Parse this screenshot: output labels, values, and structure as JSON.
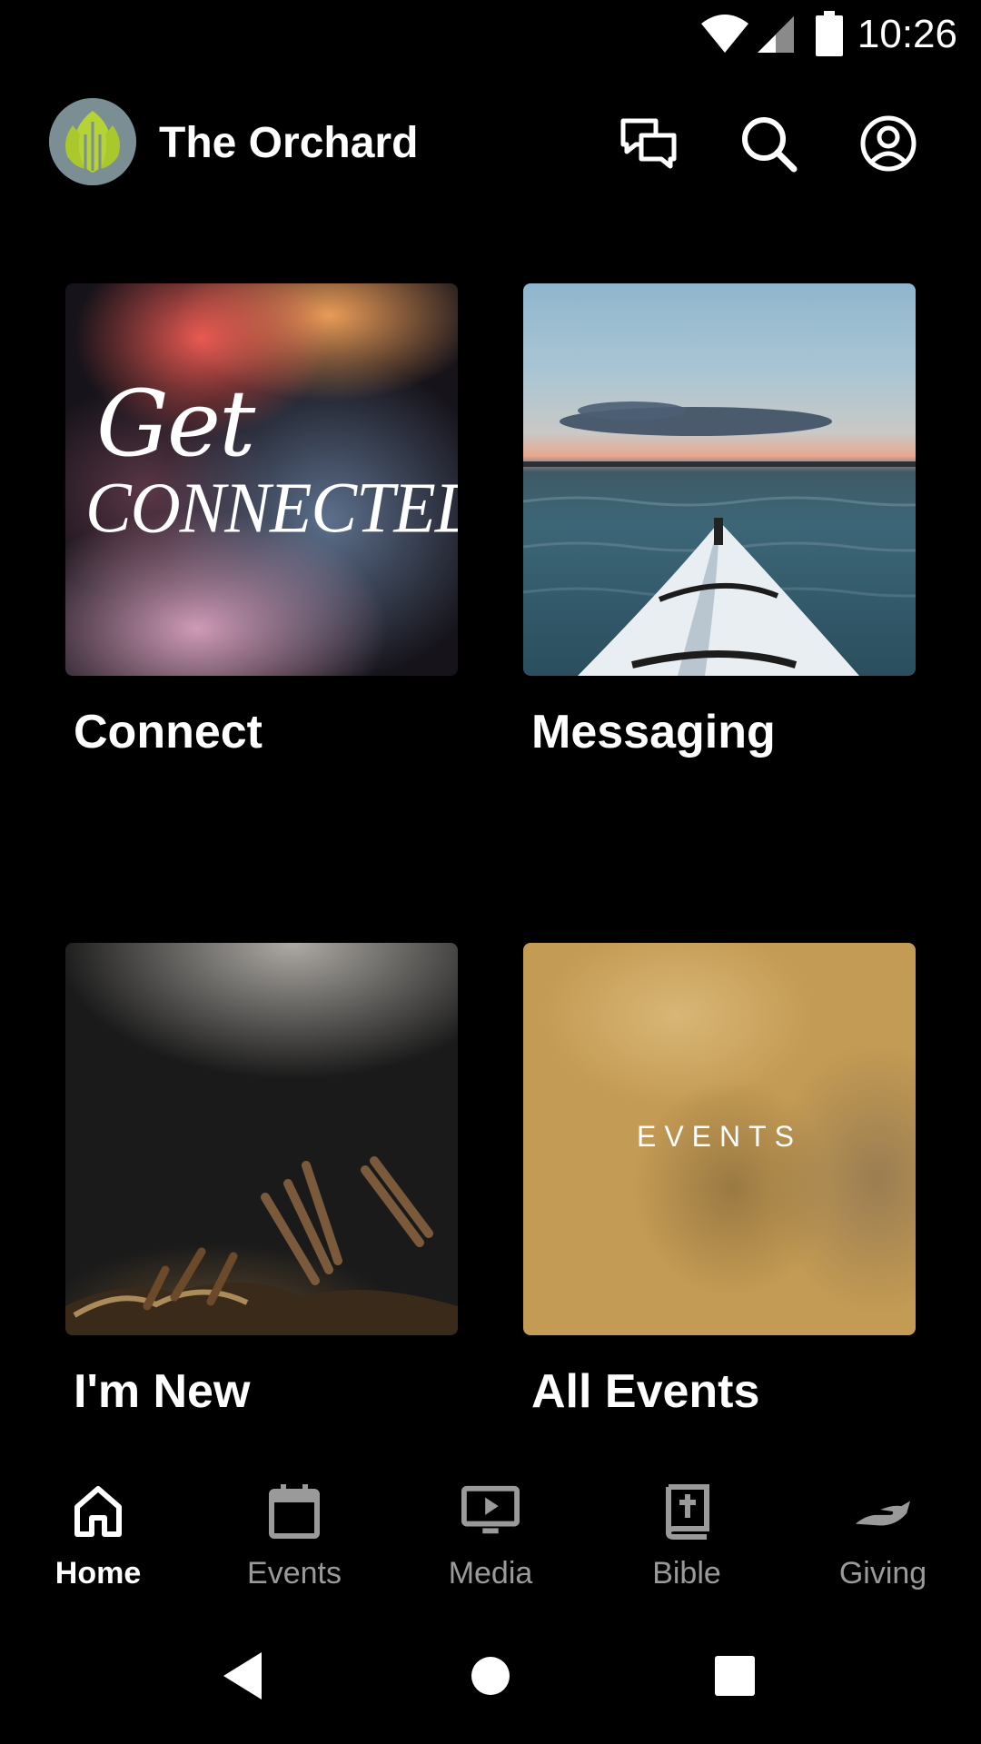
{
  "status_bar": {
    "time": "10:26",
    "icons": [
      "wifi-icon",
      "cell-signal-icon",
      "battery-icon"
    ]
  },
  "header": {
    "title": "The Orchard",
    "logo": "orchard-leaf-logo",
    "actions": [
      "messages-icon",
      "search-icon",
      "account-icon"
    ]
  },
  "tiles": [
    {
      "label": "Connect",
      "image_text": [
        "Get",
        "CONNECTED"
      ]
    },
    {
      "label": "Messaging"
    },
    {
      "label": "I'm New"
    },
    {
      "label": "All Events",
      "image_text": "EVENTS"
    }
  ],
  "bottom_nav": {
    "items": [
      {
        "label": "Home",
        "icon": "home-icon",
        "active": true
      },
      {
        "label": "Events",
        "icon": "calendar-icon",
        "active": false
      },
      {
        "label": "Media",
        "icon": "media-play-icon",
        "active": false
      },
      {
        "label": "Bible",
        "icon": "bible-icon",
        "active": false
      },
      {
        "label": "Giving",
        "icon": "giving-hand-icon",
        "active": false
      }
    ]
  },
  "system_nav": [
    "back-icon",
    "home-circle-icon",
    "recents-icon"
  ],
  "colors": {
    "background": "#000000",
    "text_primary": "#ffffff",
    "nav_inactive": "#9a9a9a",
    "logo_bg": "#7a8e93",
    "logo_leaf": "#b5d334"
  }
}
